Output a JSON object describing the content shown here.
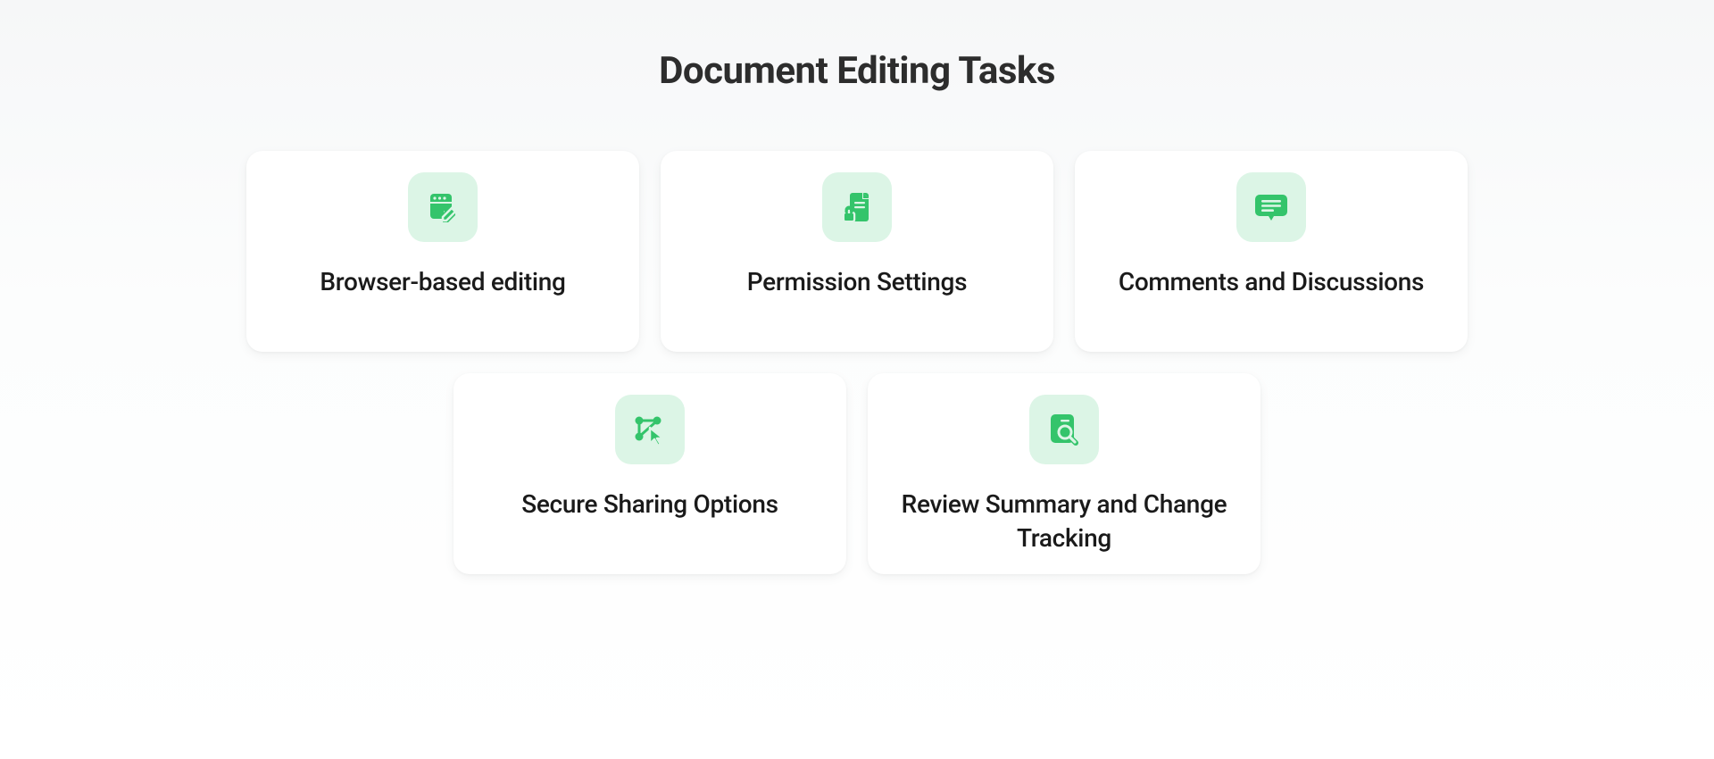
{
  "page": {
    "title": "Document Editing Tasks"
  },
  "colors": {
    "icon_bg": "#dcf5e6",
    "icon_fg": "#34c46b",
    "text": "#1a1a1a",
    "heading": "#2d2d2d"
  },
  "cards": [
    {
      "id": "browser-editing",
      "title": "Browser-based editing",
      "icon": "browser-edit"
    },
    {
      "id": "permission-settings",
      "title": "Permission Settings",
      "icon": "permission-lock"
    },
    {
      "id": "comments-discussions",
      "title": "Comments and Discussions",
      "icon": "message"
    },
    {
      "id": "secure-sharing",
      "title": "Secure Sharing Options",
      "icon": "share-cursor"
    },
    {
      "id": "review-tracking",
      "title": "Review Summary and Change Tracking",
      "icon": "review-magnify"
    }
  ]
}
